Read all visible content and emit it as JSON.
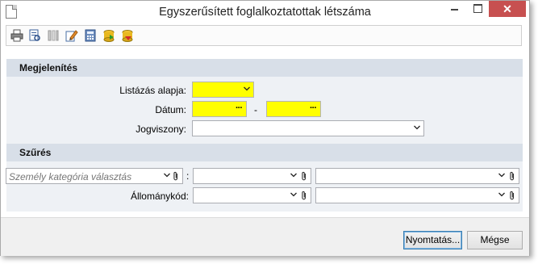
{
  "window": {
    "title": "Egyszerűsített foglalkoztatottak létszáma",
    "close_glyph": "✕"
  },
  "toolbar": {
    "icons": [
      "print-icon",
      "print-preview-icon",
      "columns-icon",
      "edit-icon",
      "calculator-icon",
      "export-icon",
      "import-icon"
    ]
  },
  "display_section": {
    "title": "Megjelenítés",
    "listing_basis_label": "Listázás alapja:",
    "listing_basis_value": "",
    "date_label": "Dátum:",
    "date_from": "",
    "date_to": "",
    "date_separator": "-",
    "date_button_glyph": "···",
    "employment_label": "Jogviszony:",
    "employment_value": ""
  },
  "filter_section": {
    "title": "Szűrés",
    "category_placeholder": "Személy kategória választás",
    "category_separator": ":",
    "category_value_1": "",
    "category_value_2": "",
    "staff_code_label": "Állománykód:",
    "staff_code_value_1": "",
    "staff_code_value_2": ""
  },
  "footer": {
    "print_label": "Nyomtatás...",
    "cancel_label": "Mégse"
  },
  "colors": {
    "required_field": "#ffff00",
    "section_band": "#d8dfe8",
    "close_button": "#c75050"
  }
}
